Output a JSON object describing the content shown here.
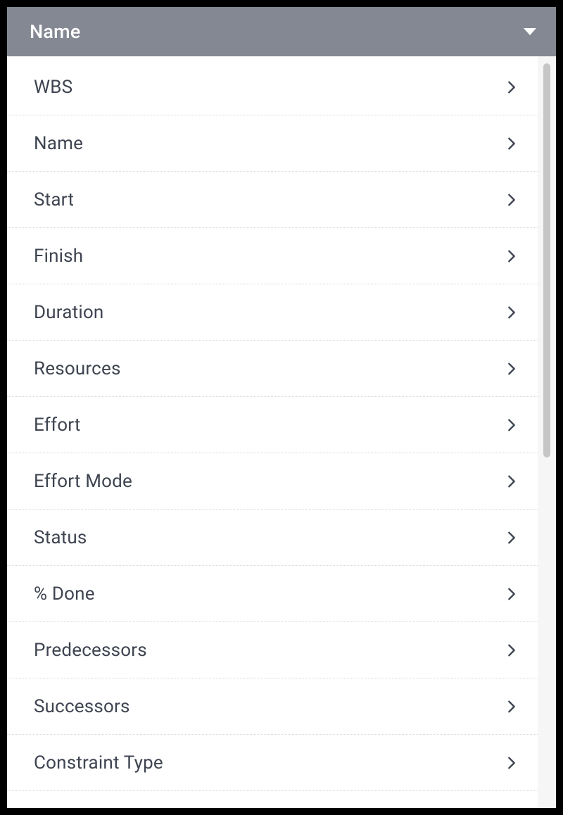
{
  "header": {
    "title": "Name"
  },
  "columns": [
    {
      "label": "WBS"
    },
    {
      "label": "Name"
    },
    {
      "label": "Start"
    },
    {
      "label": "Finish"
    },
    {
      "label": "Duration"
    },
    {
      "label": "Resources"
    },
    {
      "label": "Effort"
    },
    {
      "label": "Effort Mode"
    },
    {
      "label": "Status"
    },
    {
      "label": "% Done"
    },
    {
      "label": "Predecessors"
    },
    {
      "label": "Successors"
    },
    {
      "label": "Constraint Type"
    }
  ]
}
